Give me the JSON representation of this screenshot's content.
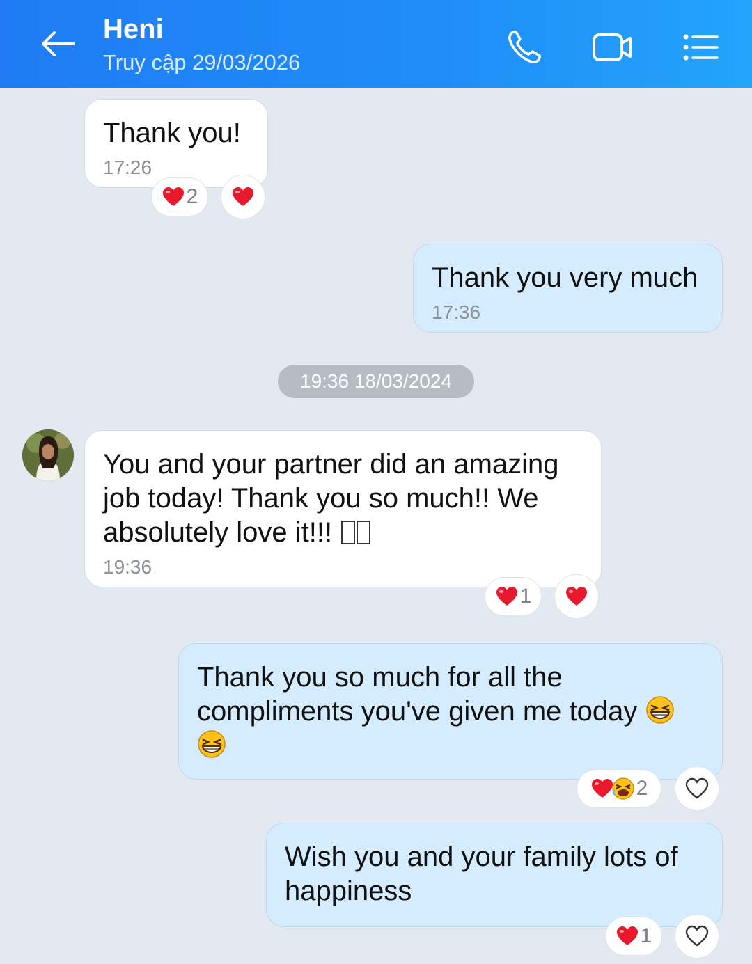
{
  "header": {
    "title": "Heni",
    "subtitle": "Truy cập 29/03/2026",
    "icons": [
      "back-arrow-icon",
      "phone-icon",
      "video-camera-icon",
      "menu-list-icon"
    ]
  },
  "messages": [
    {
      "direction": "incoming",
      "text": "Thank you!",
      "time": "17:26",
      "reactions": [
        {
          "type": "heart",
          "count": "2"
        }
      ]
    },
    {
      "direction": "outgoing",
      "text": "Thank you very much",
      "time": "17:36"
    },
    {
      "direction": "incoming",
      "text": "You and your partner did an amazing job today! Thank you so much!! We absolutely love it!!!",
      "time": "19:36",
      "reactions": [
        {
          "type": "heart",
          "count": "1"
        }
      ]
    },
    {
      "direction": "outgoing",
      "text_line1": "Thank you so much for all the",
      "text_line2": "compliments you've given me today",
      "reactions": [
        {
          "type": "heart+laugh",
          "count": "2"
        }
      ]
    },
    {
      "direction": "outgoing",
      "text": "Wish you and your family lots of happiness",
      "reactions": [
        {
          "type": "heart",
          "count": "1"
        }
      ]
    }
  ],
  "date_separator": "19:36 18/03/2024",
  "colors": {
    "header_start": "#1f7cf4",
    "header_end": "#23a4fb",
    "background": "#e2e9f1",
    "outgoing_bubble": "#d4ecfe",
    "incoming_bubble": "#ffffff",
    "heart": "#e8192c"
  }
}
